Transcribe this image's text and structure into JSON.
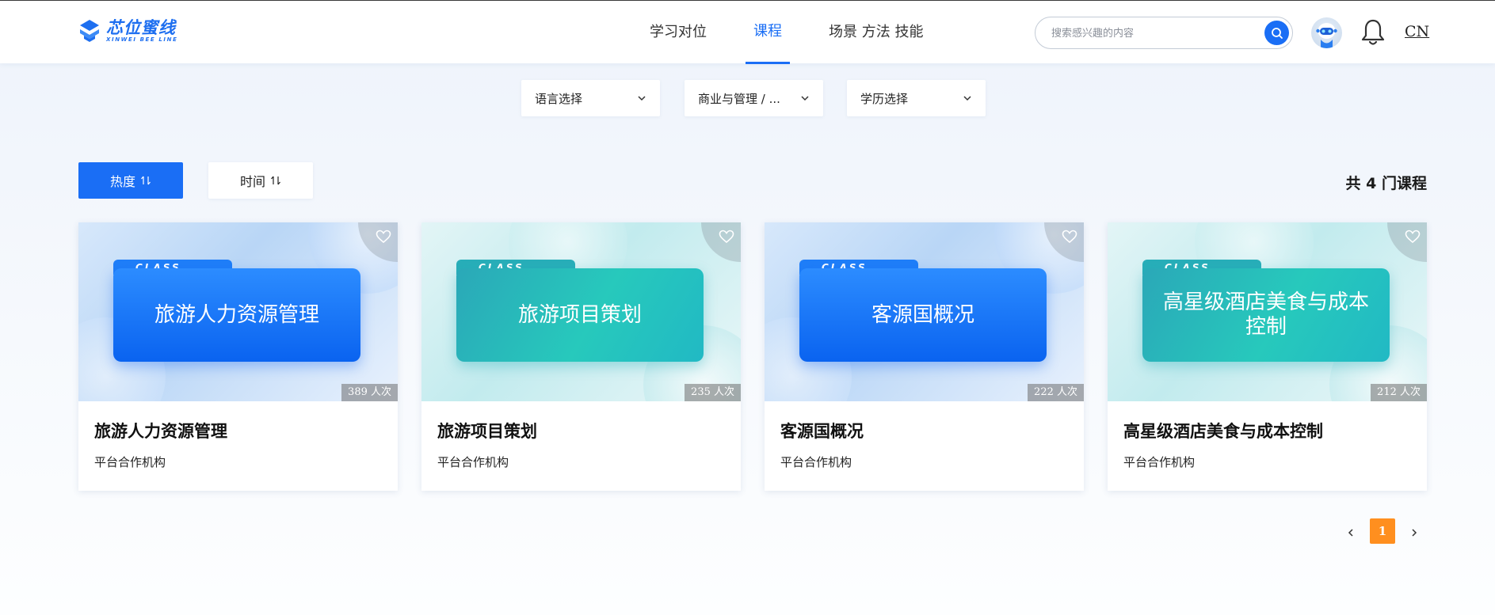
{
  "brand": {
    "name_cn": "芯位蜜线",
    "name_en": "XINWEI BEE LINE"
  },
  "nav": [
    {
      "label": "学习对位",
      "active": false
    },
    {
      "label": "课程",
      "active": true
    },
    {
      "label": "场景 方法 技能",
      "active": false
    }
  ],
  "search": {
    "placeholder": "搜索感兴趣的内容",
    "value": ""
  },
  "header": {
    "lang": "CN"
  },
  "filters": [
    {
      "label": "语言选择"
    },
    {
      "label": "商业与管理 / ..."
    },
    {
      "label": "学历选择"
    }
  ],
  "sort": [
    {
      "label": "热度",
      "active": true
    },
    {
      "label": "时间",
      "active": false
    }
  ],
  "summary": {
    "count_text": "共 4 门课程"
  },
  "courses": [
    {
      "title": "旅游人力资源管理",
      "thumb_title": "旅游人力资源管理",
      "tag": "CLASS",
      "views": "389 人次",
      "org": "平台合作机构",
      "theme": "blue"
    },
    {
      "title": "旅游项目策划",
      "thumb_title": "旅游项目策划",
      "tag": "CLASS",
      "views": "235 人次",
      "org": "平台合作机构",
      "theme": "teal"
    },
    {
      "title": "客源国概况",
      "thumb_title": "客源国概况",
      "tag": "CLASS",
      "views": "222 人次",
      "org": "平台合作机构",
      "theme": "blue"
    },
    {
      "title": "高星级酒店美食与成本控制",
      "thumb_title": "高星级酒店美食与成本控制",
      "tag": "CLASS",
      "views": "212 人次",
      "org": "平台合作机构",
      "theme": "teal"
    }
  ],
  "pagination": {
    "current": "1"
  },
  "colors": {
    "primary": "#1a6ef5",
    "accent": "#ff8f1f",
    "teal": "#27c9bc"
  }
}
